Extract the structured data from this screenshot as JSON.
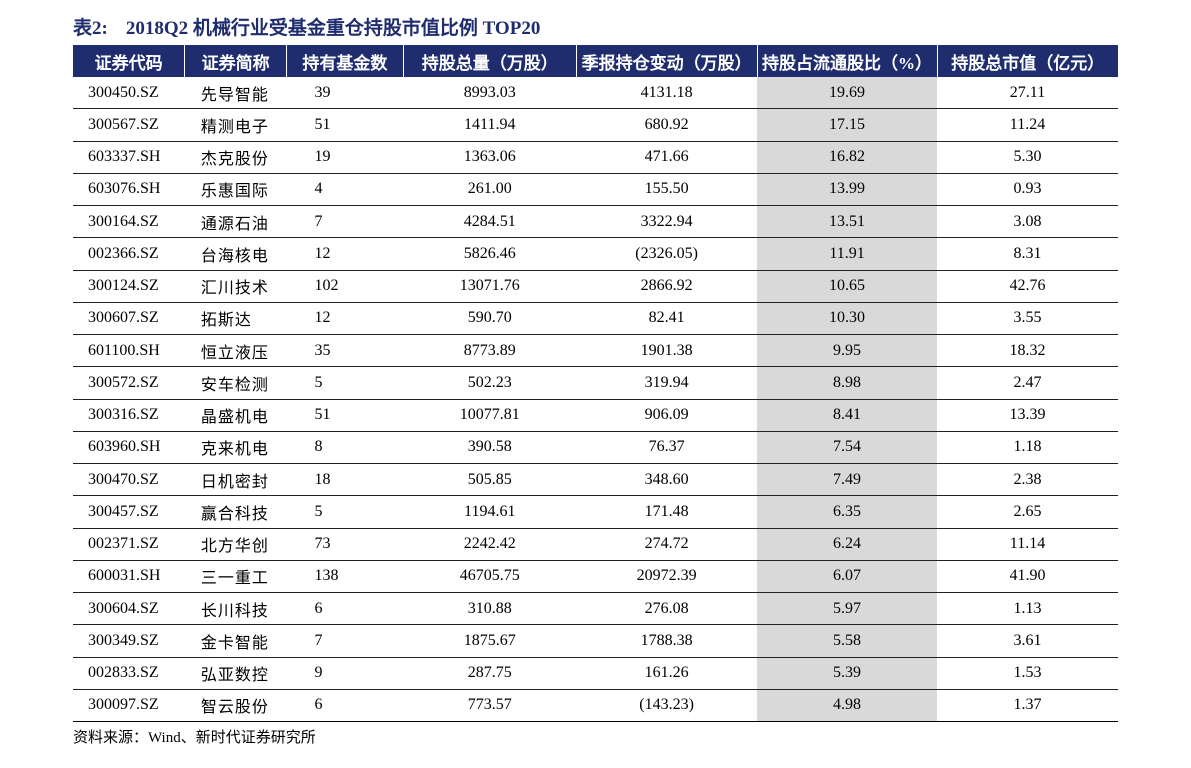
{
  "title": {
    "label": "表2:",
    "text": "2018Q2 机械行业受基金重仓持股市值比例 TOP20"
  },
  "table": {
    "headers": [
      "证券代码",
      "证券简称",
      "持有基金数",
      "持股总量（万股）",
      "季报持仓变动（万股）",
      "持股占流通股比（%）",
      "持股总市值（亿元）"
    ],
    "rows": [
      [
        "300450.SZ",
        "先导智能",
        "39",
        "8993.03",
        "4131.18",
        "19.69",
        "27.11"
      ],
      [
        "300567.SZ",
        "精测电子",
        "51",
        "1411.94",
        "680.92",
        "17.15",
        "11.24"
      ],
      [
        "603337.SH",
        "杰克股份",
        "19",
        "1363.06",
        "471.66",
        "16.82",
        "5.30"
      ],
      [
        "603076.SH",
        "乐惠国际",
        "4",
        "261.00",
        "155.50",
        "13.99",
        "0.93"
      ],
      [
        "300164.SZ",
        "通源石油",
        "7",
        "4284.51",
        "3322.94",
        "13.51",
        "3.08"
      ],
      [
        "002366.SZ",
        "台海核电",
        "12",
        "5826.46",
        "(2326.05)",
        "11.91",
        "8.31"
      ],
      [
        "300124.SZ",
        "汇川技术",
        "102",
        "13071.76",
        "2866.92",
        "10.65",
        "42.76"
      ],
      [
        "300607.SZ",
        "拓斯达",
        "12",
        "590.70",
        "82.41",
        "10.30",
        "3.55"
      ],
      [
        "601100.SH",
        "恒立液压",
        "35",
        "8773.89",
        "1901.38",
        "9.95",
        "18.32"
      ],
      [
        "300572.SZ",
        "安车检测",
        "5",
        "502.23",
        "319.94",
        "8.98",
        "2.47"
      ],
      [
        "300316.SZ",
        "晶盛机电",
        "51",
        "10077.81",
        "906.09",
        "8.41",
        "13.39"
      ],
      [
        "603960.SH",
        "克来机电",
        "8",
        "390.58",
        "76.37",
        "7.54",
        "1.18"
      ],
      [
        "300470.SZ",
        "日机密封",
        "18",
        "505.85",
        "348.60",
        "7.49",
        "2.38"
      ],
      [
        "300457.SZ",
        "赢合科技",
        "5",
        "1194.61",
        "171.48",
        "6.35",
        "2.65"
      ],
      [
        "002371.SZ",
        "北方华创",
        "73",
        "2242.42",
        "274.72",
        "6.24",
        "11.14"
      ],
      [
        "600031.SH",
        "三一重工",
        "138",
        "46705.75",
        "20972.39",
        "6.07",
        "41.90"
      ],
      [
        "300604.SZ",
        "长川科技",
        "6",
        "310.88",
        "276.08",
        "5.97",
        "1.13"
      ],
      [
        "300349.SZ",
        "金卡智能",
        "7",
        "1875.67",
        "1788.38",
        "5.58",
        "3.61"
      ],
      [
        "002833.SZ",
        "弘亚数控",
        "9",
        "287.75",
        "161.26",
        "5.39",
        "1.53"
      ],
      [
        "300097.SZ",
        "智云股份",
        "6",
        "773.57",
        "(143.23)",
        "4.98",
        "1.37"
      ]
    ],
    "highlight_color": "#d9d9d9",
    "header_bg": "#1f2d6e"
  },
  "source": "资料来源：Wind、新时代证券研究所"
}
